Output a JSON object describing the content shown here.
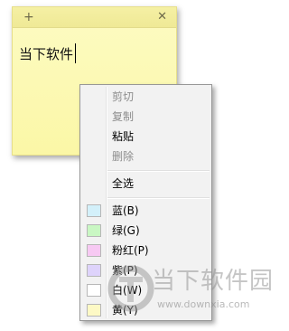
{
  "note": {
    "add_icon": "+",
    "close_icon": "✕",
    "text": "当下软件"
  },
  "context_menu": {
    "edit_items": [
      {
        "label": "剪切",
        "enabled": false
      },
      {
        "label": "复制",
        "enabled": false
      },
      {
        "label": "粘贴",
        "enabled": true
      },
      {
        "label": "删除",
        "enabled": false
      }
    ],
    "select_all": {
      "label": "全选",
      "enabled": true
    },
    "color_items": [
      {
        "label": "蓝(B)",
        "swatch": "#d3f0fa"
      },
      {
        "label": "绿(G)",
        "swatch": "#c9f7c3"
      },
      {
        "label": "粉红(P)",
        "swatch": "#f7c9f3"
      },
      {
        "label": "紫(P)",
        "swatch": "#ded3fb"
      },
      {
        "label": "白(W)",
        "swatch": "#ffffff"
      },
      {
        "label": "黄(Y)",
        "swatch": "#fdf9c5"
      }
    ]
  },
  "watermark": {
    "title": "当下软件园",
    "url": "www.downxia.com"
  }
}
